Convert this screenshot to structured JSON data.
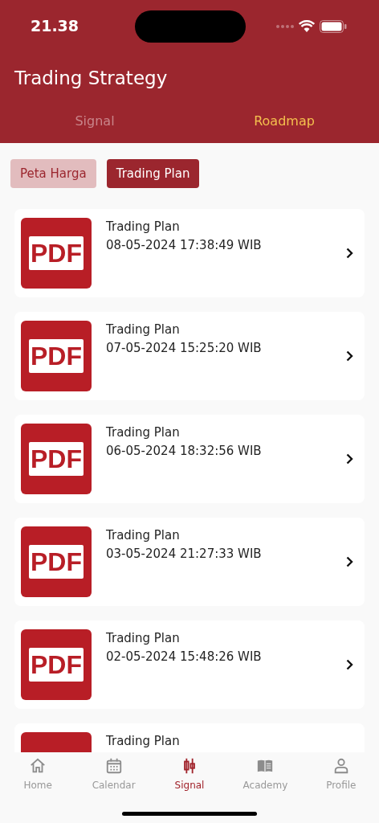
{
  "status_bar": {
    "time": "21.38"
  },
  "header": {
    "title": "Trading Strategy"
  },
  "tabs": [
    {
      "label": "Signal",
      "selected": false
    },
    {
      "label": "Roadmap",
      "selected": true
    }
  ],
  "filters": [
    {
      "label": "Peta Harga",
      "selected": false
    },
    {
      "label": "Trading Plan",
      "selected": true
    }
  ],
  "documents": [
    {
      "icon_label": "PDF",
      "title": "Trading Plan",
      "date": "08-05-2024 17:38:49 WIB"
    },
    {
      "icon_label": "PDF",
      "title": "Trading Plan",
      "date": "07-05-2024 15:25:20 WIB"
    },
    {
      "icon_label": "PDF",
      "title": "Trading Plan",
      "date": "06-05-2024 18:32:56 WIB"
    },
    {
      "icon_label": "PDF",
      "title": "Trading Plan",
      "date": "03-05-2024 21:27:33 WIB"
    },
    {
      "icon_label": "PDF",
      "title": "Trading Plan",
      "date": "02-05-2024 15:48:26 WIB"
    },
    {
      "title": "Trading Plan"
    }
  ],
  "bottom_nav": [
    {
      "kind": "home",
      "label": "Home",
      "selected": false
    },
    {
      "kind": "calendar",
      "label": "Calendar",
      "selected": false
    },
    {
      "kind": "signal",
      "label": "Signal",
      "selected": true
    },
    {
      "kind": "academy",
      "label": "Academy",
      "selected": false
    },
    {
      "kind": "profile",
      "label": "Profile",
      "selected": false
    }
  ]
}
